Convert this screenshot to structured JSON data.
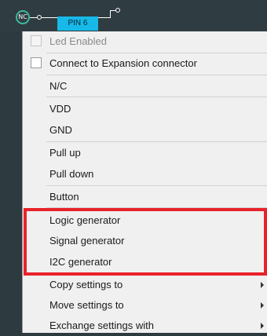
{
  "pin_bar": {
    "nc_badge": "NC",
    "pin_label": "PIN 6"
  },
  "menu": {
    "led_enabled": "Led Enabled",
    "connect_expansion": "Connect to Expansion connector",
    "nc": "N/C",
    "vdd": "VDD",
    "gnd": "GND",
    "pull_up": "Pull up",
    "pull_down": "Pull down",
    "button": "Button",
    "logic_generator": "Logic generator",
    "signal_generator": "Signal generator",
    "i2c_generator": "I2C generator",
    "copy_settings": "Copy settings to",
    "move_settings": "Move settings to",
    "exchange_settings": "Exchange settings with"
  },
  "colors": {
    "pin_tag": "#16b9e8",
    "nc_ring": "#3fb89c",
    "highlight_box": "#e8222a",
    "menu_bg": "#f0f0f0",
    "canvas_bg": "#2d3a3f"
  },
  "icons": {
    "submenu": "chevron-right-icon",
    "checkbox": "checkbox-icon"
  },
  "state": {
    "led_enabled_checked": false,
    "led_enabled_disabled": true,
    "connect_expansion_checked": false
  }
}
